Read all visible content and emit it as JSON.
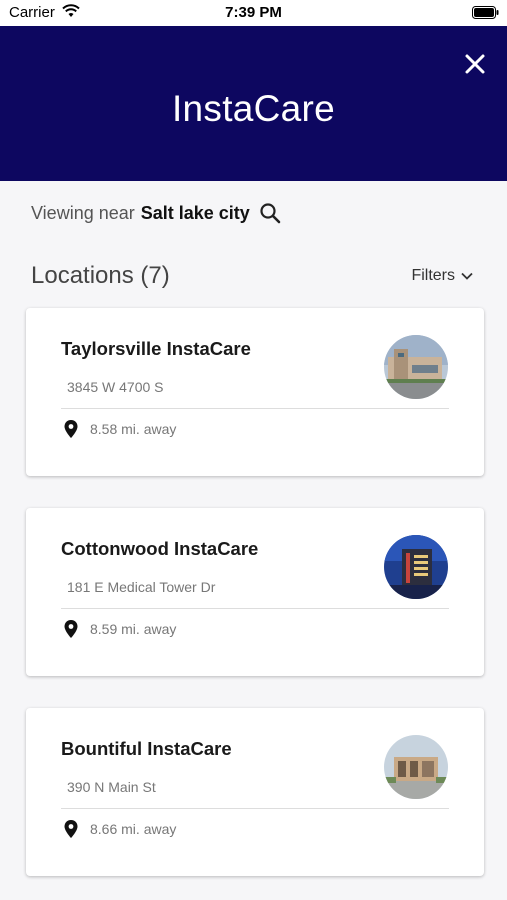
{
  "status_bar": {
    "carrier": "Carrier",
    "time": "7:39 PM"
  },
  "header": {
    "title": "InstaCare",
    "close_icon": "close-icon"
  },
  "viewing": {
    "prefix": "Viewing near",
    "city": "Salt lake city",
    "search_icon": "search-icon"
  },
  "locations": {
    "heading": "Locations (7)",
    "filters_label": "Filters"
  },
  "cards": [
    {
      "name": "Taylorsville InstaCare",
      "address": "3845 W 4700 S",
      "distance": "8.58 mi. away"
    },
    {
      "name": "Cottonwood InstaCare",
      "address": "181 E Medical Tower Dr",
      "distance": "8.59 mi. away"
    },
    {
      "name": "Bountiful InstaCare",
      "address": "390 N Main St",
      "distance": "8.66 mi. away"
    }
  ],
  "colors": {
    "header_bg": "#0d0760",
    "page_bg": "#f6f6f8"
  }
}
